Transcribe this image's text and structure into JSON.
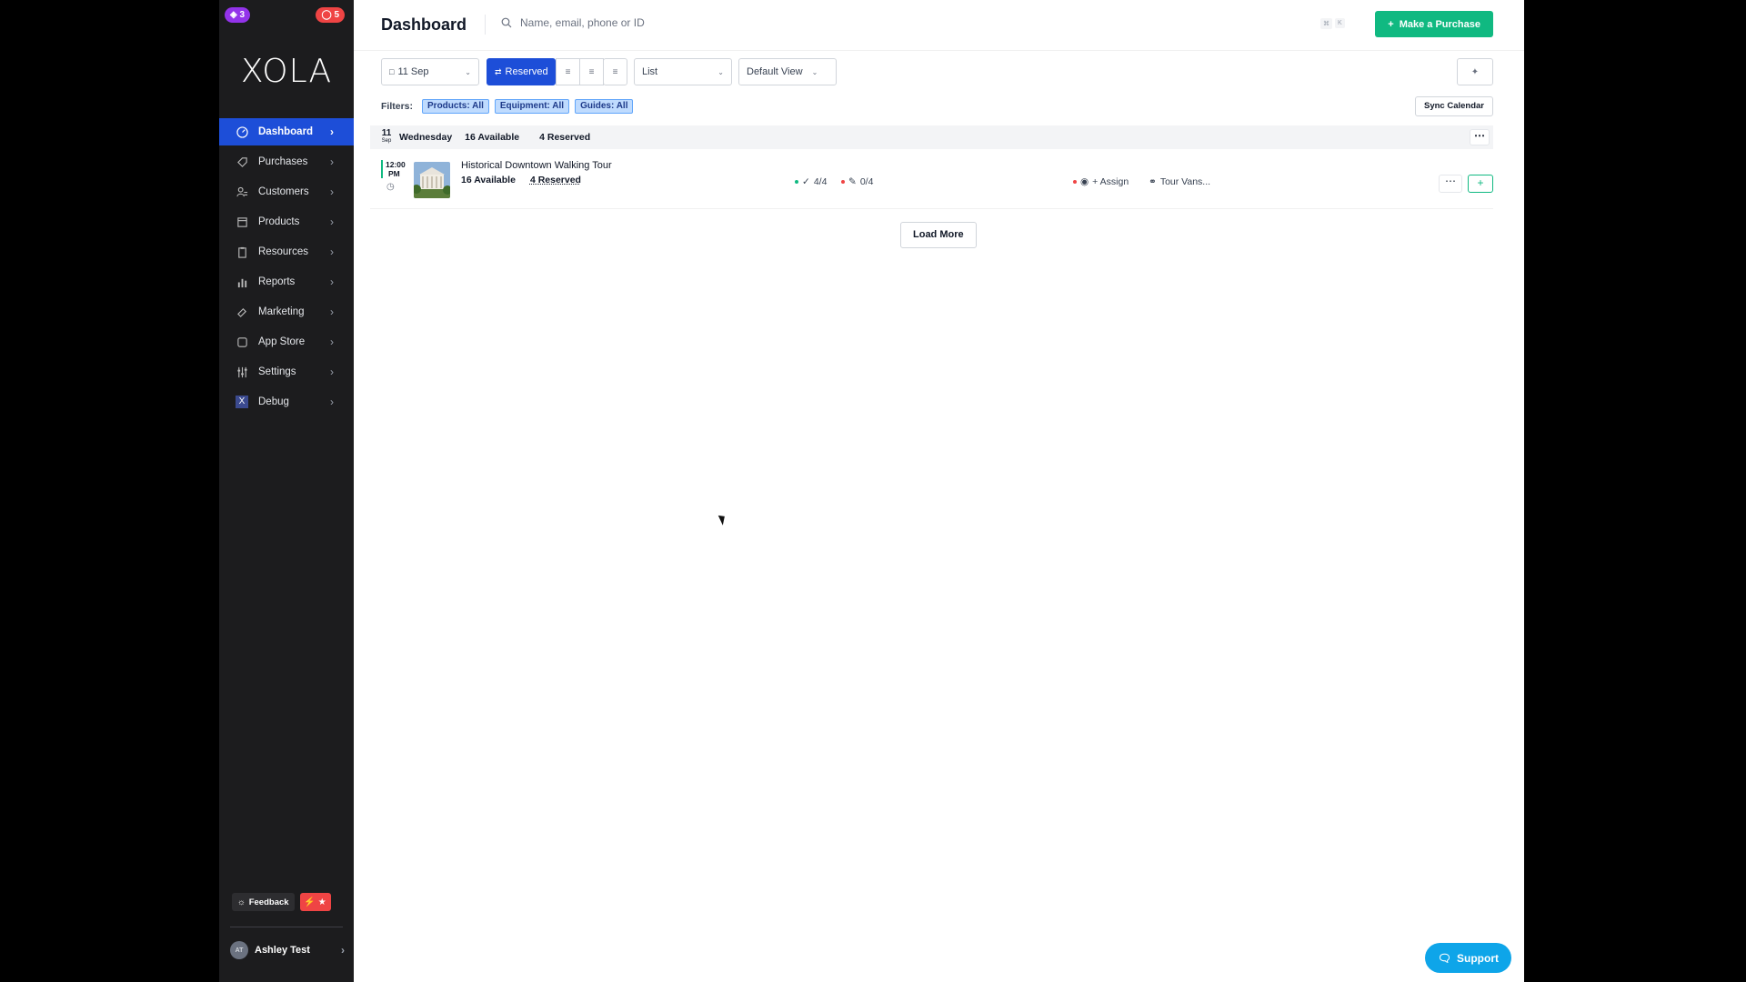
{
  "sidebar": {
    "badge_left": "3",
    "badge_right": "5",
    "logo": "XOLA",
    "items": [
      {
        "label": "Dashboard",
        "icon": "dashboard-icon"
      },
      {
        "label": "Purchases",
        "icon": "tag-icon"
      },
      {
        "label": "Customers",
        "icon": "users-icon"
      },
      {
        "label": "Products",
        "icon": "box-icon"
      },
      {
        "label": "Resources",
        "icon": "clipboard-icon"
      },
      {
        "label": "Reports",
        "icon": "bar-chart-icon"
      },
      {
        "label": "Marketing",
        "icon": "megaphone-icon"
      },
      {
        "label": "App Store",
        "icon": "square-icon"
      },
      {
        "label": "Settings",
        "icon": "sliders-icon"
      },
      {
        "label": "Debug",
        "icon": "x-icon"
      }
    ],
    "feedback_label": "Feedback",
    "user_name": "Ashley Test",
    "user_initials": "AT"
  },
  "header": {
    "title": "Dashboard",
    "search_placeholder": "Name, email, phone or ID",
    "kbd1": "⌘",
    "kbd2": "K",
    "make_purchase": "Make a Purchase"
  },
  "toolbar": {
    "date": "11 Sep",
    "reserved": "Reserved",
    "view_mode": "List",
    "view_preset": "Default View"
  },
  "filters": {
    "label": "Filters:",
    "chips": [
      "Products: All",
      "Equipment: All",
      "Guides: All"
    ],
    "sync": "Sync Calendar"
  },
  "day": {
    "num": "11",
    "month": "Sep",
    "weekday": "Wednesday",
    "available": "16 Available",
    "reserved": "4 Reserved"
  },
  "event": {
    "time": "12:00",
    "ampm": "PM",
    "title": "Historical Downtown Walking Tour",
    "available": "16 Available",
    "reserved": "4 Reserved",
    "checkin": "4/4",
    "waivers": "0/4",
    "assign": "+ Assign",
    "resource": "Tour Vans..."
  },
  "load_more": "Load More",
  "support": "Support",
  "colors": {
    "accent_blue": "#1d4ed8",
    "accent_green": "#10b981",
    "sidebar_bg": "#1c1c1e"
  }
}
